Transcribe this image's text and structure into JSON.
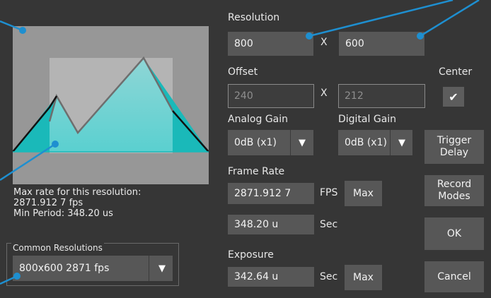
{
  "resolution": {
    "label": "Resolution",
    "width": "800",
    "separator": "X",
    "height": "600"
  },
  "offset": {
    "label": "Offset",
    "x": "240",
    "separator": "X",
    "y": "212"
  },
  "center": {
    "label": "Center",
    "check_glyph": "✔"
  },
  "analog_gain": {
    "label": "Analog Gain",
    "value": "0dB (x1)",
    "arrow_icon": "▼"
  },
  "digital_gain": {
    "label": "Digital Gain",
    "value": "0dB (x1)",
    "arrow_icon": "▼"
  },
  "frame_rate": {
    "label": "Frame Rate",
    "fps_value": "2871.912 7",
    "fps_unit": "FPS",
    "max_label": "Max",
    "period_value": "348.20 u",
    "period_unit": "Sec"
  },
  "exposure": {
    "label": "Exposure",
    "value": "342.64 u",
    "unit": "Sec",
    "max_label": "Max"
  },
  "buttons": {
    "trigger_delay": "Trigger\nDelay",
    "record_modes": "Record\nModes",
    "ok": "OK",
    "cancel": "Cancel"
  },
  "info": {
    "line1": "Max rate for this resolution:",
    "line2": "2871.912 7 fps",
    "line3": "Min Period: 348.20 us"
  },
  "common_resolutions": {
    "title": "Common Resolutions",
    "selected": "800x600 2871 fps",
    "arrow_icon": "▼"
  },
  "colors": {
    "background": "#363636",
    "field": "#575757",
    "callout": "#1e8fd0",
    "sensor_area": "#979797",
    "roi_area": "#b4b4b4",
    "teal": "#20c0c0"
  }
}
